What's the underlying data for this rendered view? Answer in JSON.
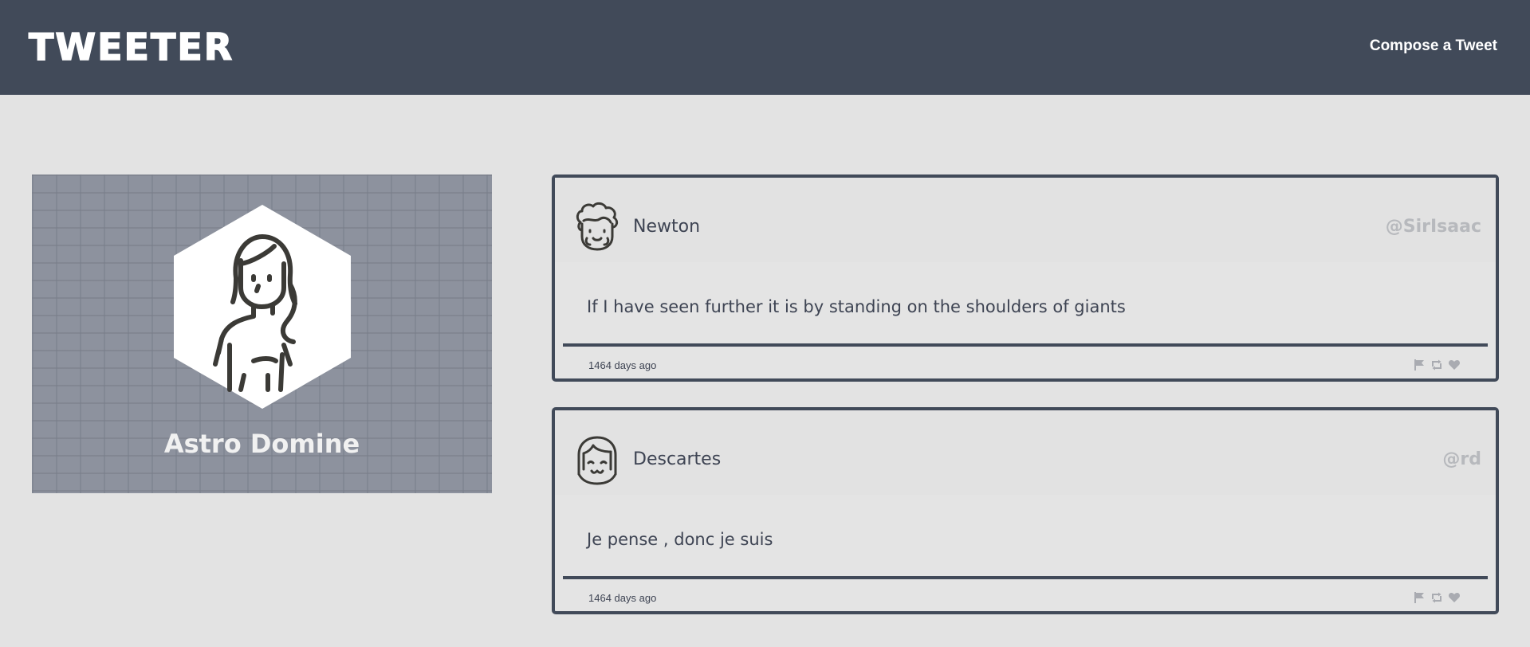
{
  "header": {
    "logo": "TWEETER",
    "compose_label": "Compose a Tweet",
    "background": "#414a59"
  },
  "profile": {
    "name": "Astro Domine",
    "avatar_icon": "woman-avatar-icon"
  },
  "tweets": [
    {
      "name": "Newton",
      "handle": "@SirIsaac",
      "text": "If I have seen further it is by standing on the shoulders of giants",
      "time": "1464 days ago",
      "avatar_icon": "curly-hair-face-icon",
      "actions": [
        "flag-icon",
        "retweet-icon",
        "heart-icon"
      ]
    },
    {
      "name": "Descartes",
      "handle": "@rd",
      "text": "Je pense , donc je suis",
      "time": "1464 days ago",
      "avatar_icon": "bob-hair-face-icon",
      "actions": [
        "flag-icon",
        "retweet-icon",
        "heart-icon"
      ]
    }
  ]
}
